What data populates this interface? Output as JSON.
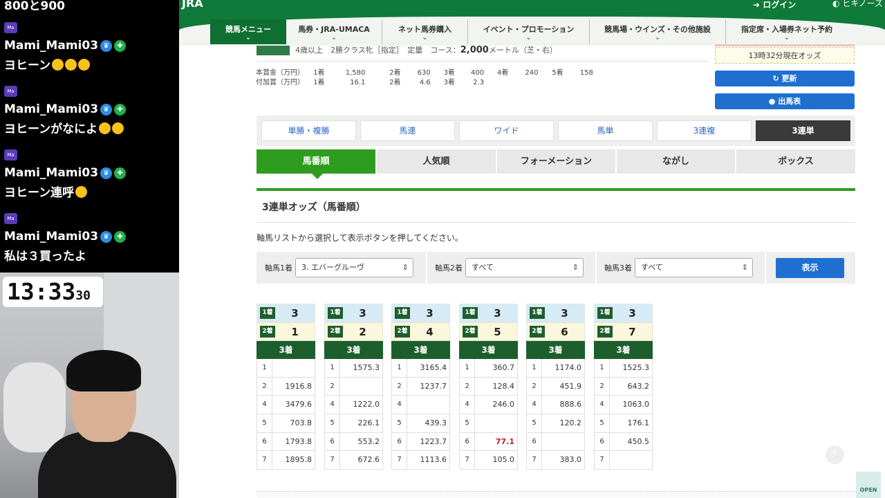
{
  "chat": {
    "top_text": "800と900",
    "messages": [
      {
        "user": "Mami_Mami03",
        "text": "ヨヒーン"
      },
      {
        "user": "Mami_Mami03",
        "text": "ヨヒーンがなによ"
      },
      {
        "user": "Mami_Mami03",
        "text": "ヨヒーン連呼"
      },
      {
        "user": "Mami_Mami03",
        "text": "私は３買ったよ"
      }
    ],
    "badge": "Ma"
  },
  "clock": {
    "time": "13:33",
    "seconds": "30"
  },
  "header": {
    "logo": "JRA",
    "login": "ログイン",
    "other": "ヒキノーズ",
    "nav": [
      "競馬メニュー",
      "馬券・JRA-UMACA",
      "ネット馬券購入",
      "イベント・プロモーション",
      "競馬場・ウインズ・その他施設",
      "指定席・入場券ネット予約"
    ]
  },
  "race": {
    "info": "4歳以上　2勝クラス牝［指定］　定量　コース：",
    "distance": "2,000",
    "unit": "メートル（芝・右）",
    "prize_label": "本賞金（万円）",
    "prize": [
      "1着",
      "1,580",
      "2着",
      "630",
      "3着",
      "400",
      "4着",
      "240",
      "5着",
      "158"
    ],
    "add_label": "付加賞（万円）",
    "add": [
      "1着",
      "16.1",
      "2着",
      "4.6",
      "3着",
      "2.3"
    ]
  },
  "side": {
    "odds_time": "13時32分現在オッズ",
    "refresh": "更新",
    "entries": "出馬表"
  },
  "bet_types": [
    "単勝・複勝",
    "馬連",
    "ワイド",
    "馬単",
    "3連複",
    "3連単"
  ],
  "sort_tabs": [
    "馬番順",
    "人気順",
    "フォーメーション",
    "ながし",
    "ボックス"
  ],
  "section_title": "3連単オッズ（馬番順）",
  "instruction": "軸馬リストから選択して表示ボタンを押してください。",
  "selectors": {
    "first_label": "軸馬1着",
    "first_value": "3. エバーグルーヴ",
    "second_label": "軸馬2着",
    "second_value": "すべて",
    "third_label": "軸馬3着",
    "third_value": "すべて",
    "show": "表示"
  },
  "odds_tables": {
    "first_tag": "1着",
    "second_tag": "2着",
    "third_tag": "3着",
    "tables": [
      {
        "first": "3",
        "second": "1",
        "rows": [
          [
            "1",
            ""
          ],
          [
            "2",
            "1916.8"
          ],
          [
            "4",
            "3479.6"
          ],
          [
            "5",
            "703.8"
          ],
          [
            "6",
            "1793.8"
          ],
          [
            "7",
            "1895.8"
          ]
        ]
      },
      {
        "first": "3",
        "second": "2",
        "rows": [
          [
            "1",
            "1575.3"
          ],
          [
            "2",
            ""
          ],
          [
            "4",
            "1222.0"
          ],
          [
            "5",
            "226.1"
          ],
          [
            "6",
            "553.2"
          ],
          [
            "7",
            "672.6"
          ]
        ]
      },
      {
        "first": "3",
        "second": "4",
        "rows": [
          [
            "1",
            "3165.4"
          ],
          [
            "2",
            "1237.7"
          ],
          [
            "4",
            ""
          ],
          [
            "5",
            "439.3"
          ],
          [
            "6",
            "1223.7"
          ],
          [
            "7",
            "1113.6"
          ]
        ]
      },
      {
        "first": "3",
        "second": "5",
        "rows": [
          [
            "1",
            "360.7"
          ],
          [
            "2",
            "128.4"
          ],
          [
            "4",
            "246.0"
          ],
          [
            "5",
            ""
          ],
          [
            "6",
            "77.1"
          ],
          [
            "7",
            "105.0"
          ]
        ]
      },
      {
        "first": "3",
        "second": "6",
        "rows": [
          [
            "1",
            "1174.0"
          ],
          [
            "2",
            "451.9"
          ],
          [
            "4",
            "888.6"
          ],
          [
            "5",
            "120.2"
          ],
          [
            "6",
            ""
          ],
          [
            "7",
            "383.0"
          ]
        ]
      },
      {
        "first": "3",
        "second": "7",
        "rows": [
          [
            "1",
            "1525.3"
          ],
          [
            "2",
            "643.2"
          ],
          [
            "4",
            "1063.0"
          ],
          [
            "5",
            "176.1"
          ],
          [
            "6",
            "450.5"
          ],
          [
            "7",
            ""
          ]
        ]
      }
    ]
  },
  "open_label": "OPEN",
  "colors": {
    "jra_green": "#0f7a39",
    "tab_green": "#2e9c1f",
    "blue": "#1f6fd0",
    "highlight": "#c0182c"
  }
}
